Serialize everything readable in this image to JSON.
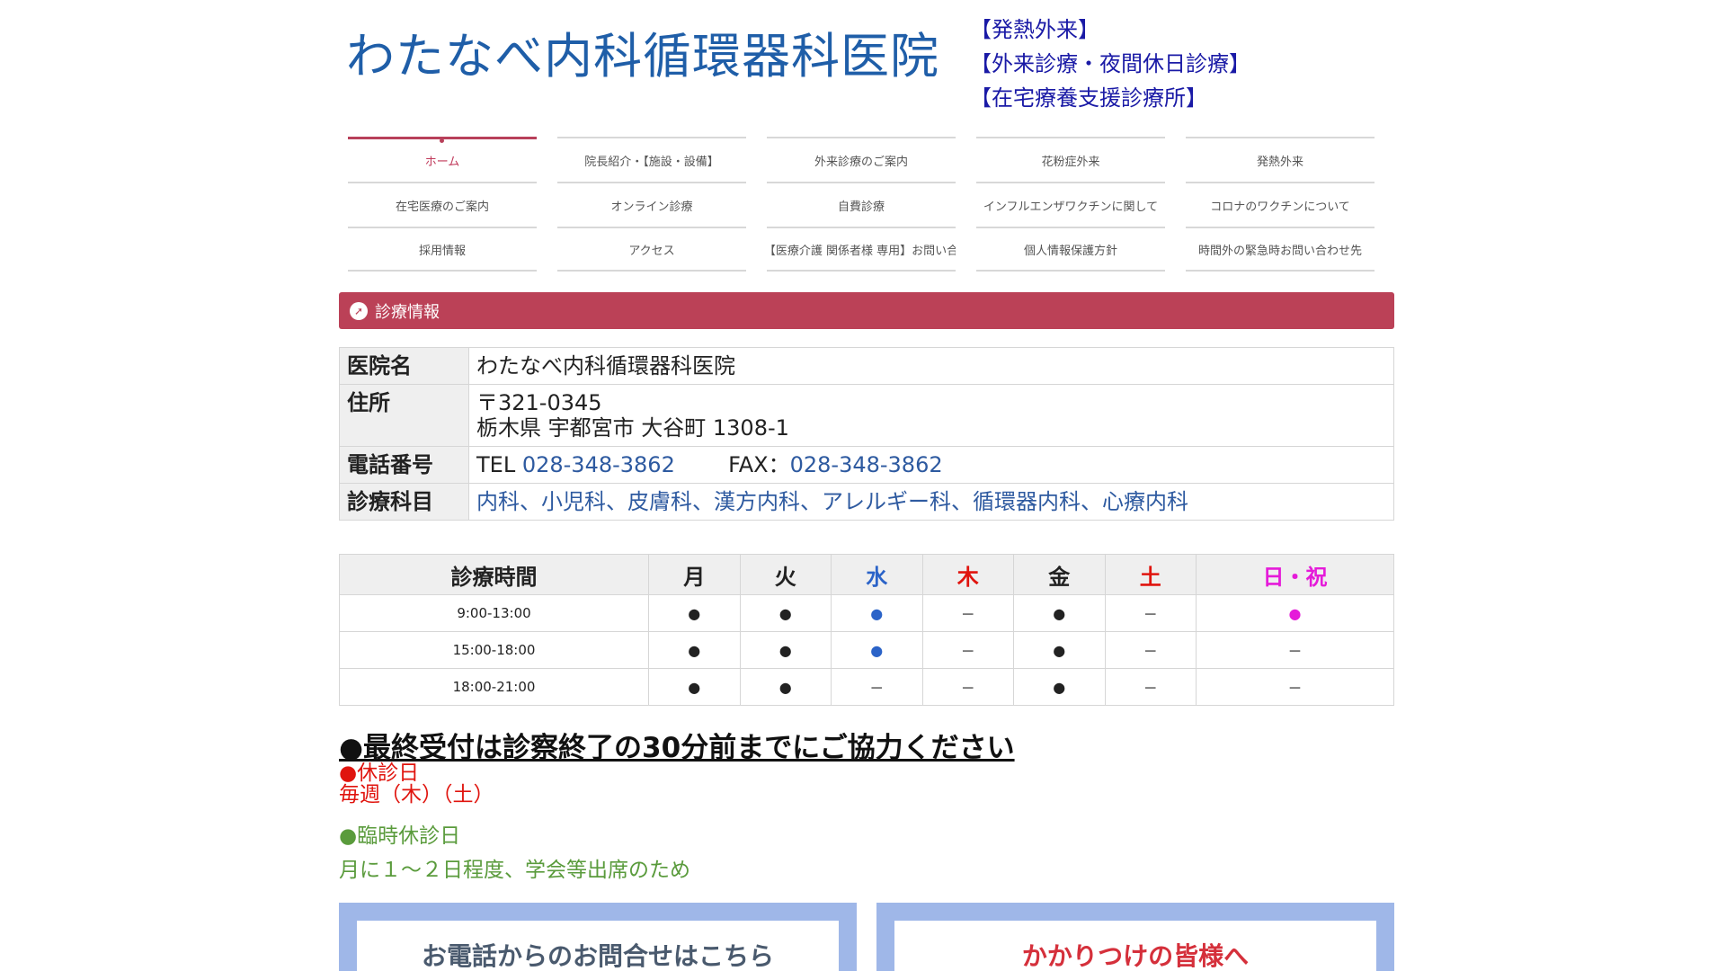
{
  "header": {
    "logo": "わたなべ内科循環器科医院",
    "links": [
      "【発熱外来】",
      "【外来診療・夜間休日診療】",
      "【在宅療養支援診療所】"
    ]
  },
  "nav": {
    "items": [
      "ホーム",
      "院長紹介・【施設・設備】",
      "外来診療のご案内",
      "花粉症外来",
      "発熱外来",
      "在宅医療のご案内",
      "オンライン診療",
      "自費診療",
      "インフルエンザワクチンに関して",
      "コロナのワクチンについて",
      "採用情報",
      "アクセス",
      "【医療介護 関係者様 専用】お問い合",
      "個人情報保護方針",
      "時間外の緊急時お問い合わせ先"
    ],
    "active_index": 0
  },
  "section": {
    "icon": "arrow-icon",
    "title": "診療情報"
  },
  "info": {
    "name_label": "医院名",
    "name_value": "わたなべ内科循環器科医院",
    "address_label": "住所",
    "postal": "〒321-0345",
    "address": "栃木県 宇都宮市 大谷町 1308-1",
    "phone_label": "電話番号",
    "tel_prefix": "TEL ",
    "tel": "028-348-3862",
    "fax_prefix": "FAX：",
    "fax": "028-348-3862",
    "depts_label": "診療科目",
    "depts": "内科、小児科、皮膚科、漢方内科、アレルギー科、循環器内科、心療内科"
  },
  "schedule": {
    "header": [
      "診療時間",
      "月",
      "火",
      "水",
      "木",
      "金",
      "土",
      "日・祝"
    ],
    "rows": [
      {
        "time": "9:00-13:00",
        "cells": [
          "●",
          "●",
          "●",
          "－",
          "●",
          "－",
          "●"
        ]
      },
      {
        "time": "15:00-18:00",
        "cells": [
          "●",
          "●",
          "●",
          "－",
          "●",
          "－",
          "－"
        ]
      },
      {
        "time": "18:00-21:00",
        "cells": [
          "●",
          "●",
          "－",
          "－",
          "●",
          "－",
          "－"
        ]
      }
    ],
    "colors": {
      "wed": "#2b63c8",
      "thu": "#e0140e",
      "sat": "#e0140e",
      "sun": "#e51bd9"
    }
  },
  "notes": {
    "notice": "●最終受付は診察終了の30分前までにご協力ください",
    "closed_title": "●休診日",
    "closed_days": "毎週（木）（土）",
    "temp_title": "●臨時休診日",
    "temp_desc": "月に１～２日程度、学会等出席のため"
  },
  "banners": {
    "left": "お電話からのお問合せはこちら",
    "right": "かかりつけの皆様へ"
  }
}
